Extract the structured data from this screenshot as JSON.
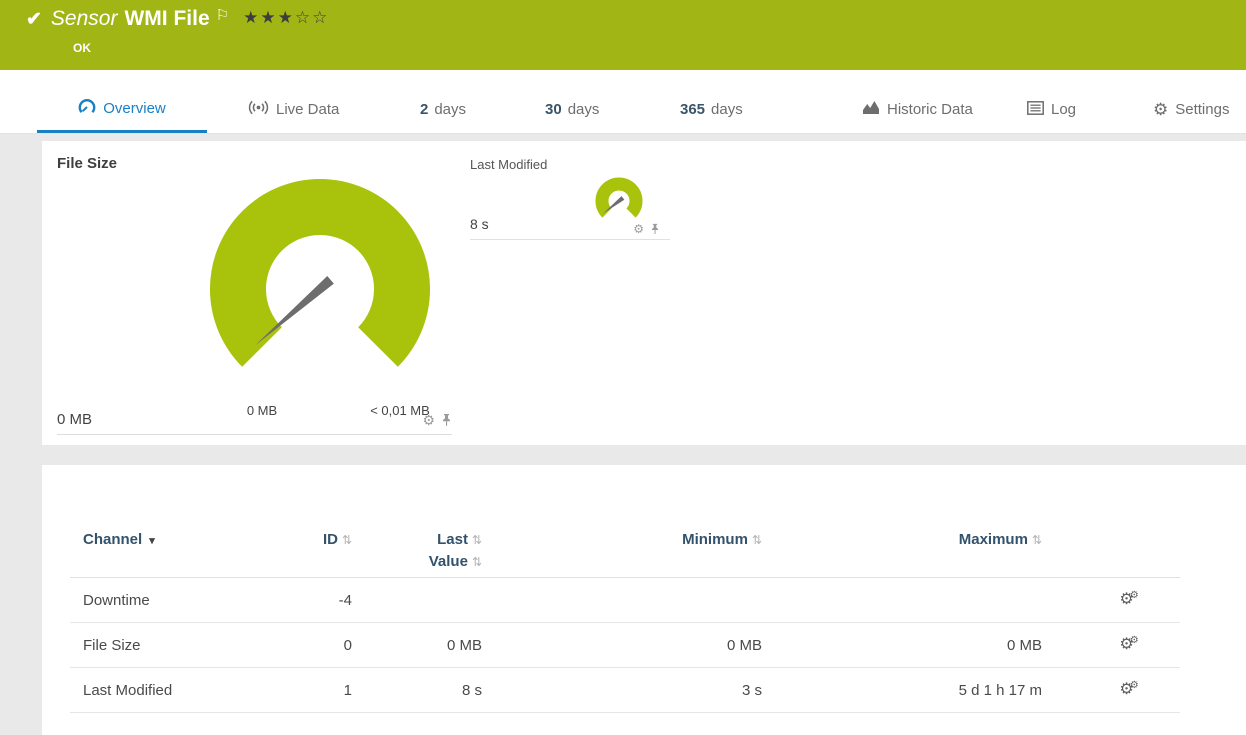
{
  "colors": {
    "header_green": "#a1b515",
    "gauge_green": "#a9c30d",
    "active_tab_blue": "#1a80c4",
    "table_header_blue": "#33526b"
  },
  "header": {
    "check_icon": "✔",
    "type_label": "Sensor",
    "title": "WMI File",
    "flag_icon": "⚐",
    "stars_filled": "★★★",
    "stars_empty": "☆☆",
    "status": "OK"
  },
  "tabs": {
    "overview": {
      "label": "Overview"
    },
    "live_data": {
      "label": "Live Data"
    },
    "d2": {
      "number": "2",
      "unit": "days"
    },
    "d30": {
      "number": "30",
      "unit": "days"
    },
    "d365": {
      "number": "365",
      "unit": "days"
    },
    "historic": {
      "label": "Historic Data"
    },
    "log": {
      "label": "Log"
    },
    "settings": {
      "label": "Settings"
    }
  },
  "gauges": {
    "file_size": {
      "title": "File Size",
      "value": "0 MB",
      "scale_min": "0 MB",
      "scale_max": "< 0,01 MB"
    },
    "last_modified": {
      "title": "Last Modified",
      "value": "8 s"
    }
  },
  "icons": {
    "gear": "⚙",
    "sort": "⇅",
    "sort_active": "▾"
  },
  "table": {
    "headers": {
      "channel": "Channel",
      "id": "ID",
      "last_value_1": "Last",
      "last_value_2": "Value",
      "minimum": "Minimum",
      "maximum": "Maximum"
    },
    "rows": [
      {
        "channel": "Downtime",
        "id": "-4",
        "last_value": "",
        "minimum": "",
        "maximum": ""
      },
      {
        "channel": "File Size",
        "id": "0",
        "last_value": "0 MB",
        "minimum": "0 MB",
        "maximum": "0 MB"
      },
      {
        "channel": "Last Modified",
        "id": "1",
        "last_value": "8 s",
        "minimum": "3 s",
        "maximum": "5 d 1 h 17 m"
      }
    ]
  }
}
